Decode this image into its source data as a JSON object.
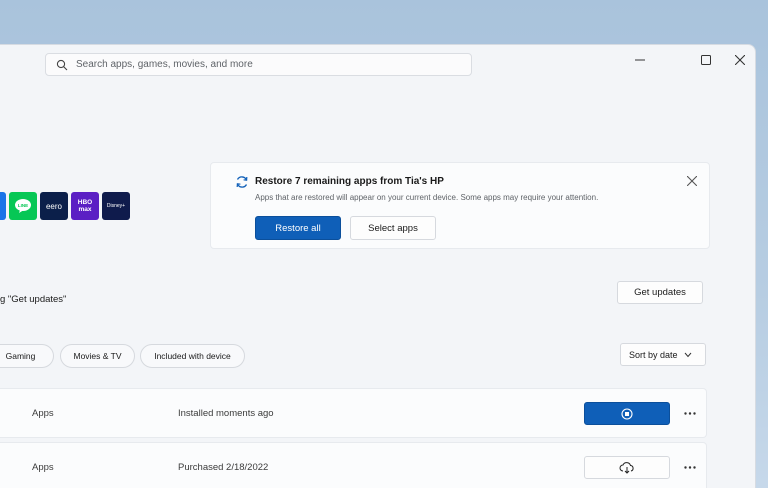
{
  "search": {
    "placeholder": "Search apps, games, movies, and more"
  },
  "restore_banner": {
    "title": "Restore 7 remaining apps from Tia's HP",
    "description": "Apps that are restored will appear on your current device. Some apps may require your attention.",
    "restore_all_label": "Restore all",
    "select_apps_label": "Select apps"
  },
  "app_tiles": [
    {
      "name": "partial-app",
      "label": "",
      "color": "#1a73e8"
    },
    {
      "name": "line",
      "label": "LINE",
      "color": "#06c755"
    },
    {
      "name": "eero",
      "label": "eero",
      "color": "#0b1f4a"
    },
    {
      "name": "hbo-max",
      "label": "HBO max",
      "color": "#5b1fc4"
    },
    {
      "name": "disney-plus",
      "label": "Disney+",
      "color": "#0f1b4c"
    }
  ],
  "updates": {
    "text": "g \"Get updates\"",
    "button_label": "Get updates"
  },
  "filters": {
    "chips": [
      "Gaming",
      "Movies & TV",
      "Included with device"
    ],
    "sort_label": "Sort by date"
  },
  "rows": [
    {
      "category": "Apps",
      "status": "Installed moments ago",
      "action": "stop"
    },
    {
      "category": "Apps",
      "status": "Purchased 2/18/2022",
      "action": "download"
    }
  ],
  "colors": {
    "accent": "#0f5fb8",
    "background": "#f3f5f8"
  }
}
